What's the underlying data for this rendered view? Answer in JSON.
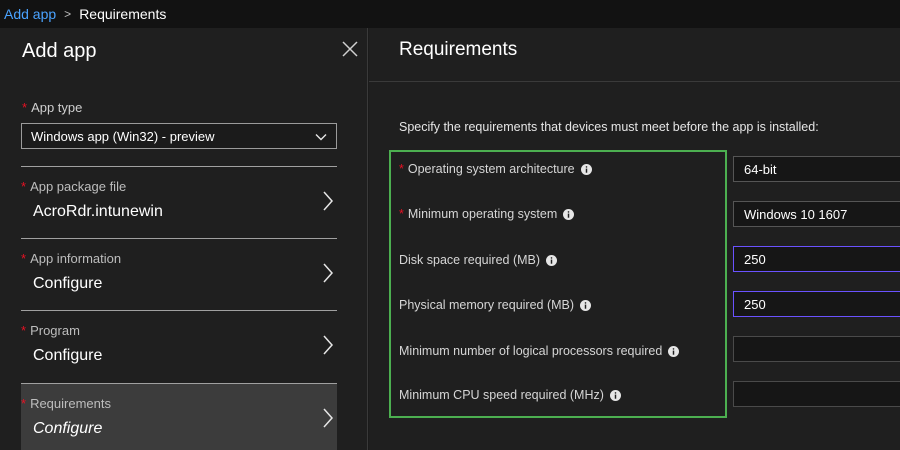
{
  "breadcrumb": {
    "link": "Add app",
    "current": "Requirements"
  },
  "left": {
    "title": "Add app",
    "app_type": {
      "label": "App type",
      "value": "Windows app (Win32) - preview"
    },
    "nav": [
      {
        "label": "App package file",
        "value": "AcroRdr.intunewin"
      },
      {
        "label": "App information",
        "value": "Configure"
      },
      {
        "label": "Program",
        "value": "Configure"
      },
      {
        "label": "Requirements",
        "value": "Configure"
      }
    ]
  },
  "right": {
    "title": "Requirements",
    "description": "Specify the requirements that devices must meet before the app is installed:",
    "fields": [
      {
        "label": "Operating system architecture",
        "value": "64-bit",
        "required": true
      },
      {
        "label": "Minimum operating system",
        "value": "Windows 10 1607",
        "required": true
      },
      {
        "label": "Disk space required (MB)",
        "value": "250",
        "required": false
      },
      {
        "label": "Physical memory required (MB)",
        "value": "250",
        "required": false
      },
      {
        "label": "Minimum number of logical processors required",
        "value": "",
        "required": false
      },
      {
        "label": "Minimum CPU speed required (MHz)",
        "value": "",
        "required": false
      }
    ]
  },
  "colors": {
    "accent_link": "#4aa3ff",
    "required_star": "#e81123",
    "highlight_box": "#4caf50",
    "input_focus": "#6a52ff"
  },
  "icons": {
    "close": "close-icon",
    "chevron": "chevron-right-icon",
    "dropdown": "chevron-down-icon",
    "info": "info-icon"
  }
}
